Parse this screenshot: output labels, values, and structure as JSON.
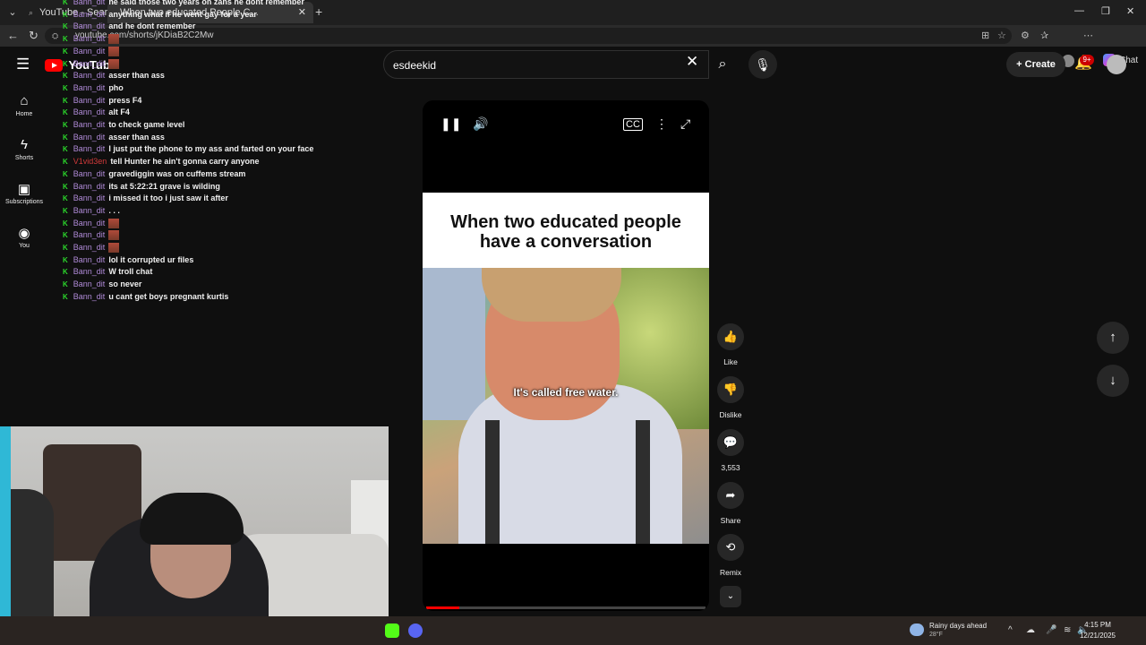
{
  "browser": {
    "tab_menu_icon": "chevron-down-icon",
    "tabs": [
      {
        "title": "YouTube - Search"
      },
      {
        "title": "When two educated People C..."
      }
    ],
    "url": "youtube.com/shorts/jKDiaB2C2Mw"
  },
  "youtube": {
    "logo_text": "YouTube",
    "search": {
      "value": "esdeekid",
      "placeholder": "Search"
    },
    "create_label": "Create",
    "notif_count": "9+"
  },
  "guide": [
    {
      "label": "Home",
      "icon": "home-icon"
    },
    {
      "label": "Shorts",
      "icon": "shorts-icon"
    },
    {
      "label": "Subscriptions",
      "icon": "subscriptions-icon"
    },
    {
      "label": "You",
      "icon": "you-icon"
    }
  ],
  "chat": [
    {
      "user": "Bann_dit",
      "msg": "he said those two years on zans he dont remember"
    },
    {
      "user": "Bann_dit",
      "msg": "anything what if he went gay for a year"
    },
    {
      "user": "Bann_dit",
      "msg": "and he dont remember"
    },
    {
      "user": "Bann_dit",
      "msg": ""
    },
    {
      "user": "Bann_dit",
      "msg": ""
    },
    {
      "user": "Bann_dit",
      "msg": ""
    },
    {
      "user": "Bann_dit",
      "msg": "asser than ass"
    },
    {
      "user": "Bann_dit",
      "msg": "pho"
    },
    {
      "user": "Bann_dit",
      "msg": "press F4"
    },
    {
      "user": "Bann_dit",
      "msg": "alt F4"
    },
    {
      "user": "Bann_dit",
      "msg": "to check game level"
    },
    {
      "user": "Bann_dit",
      "msg": "asser than ass"
    },
    {
      "user": "Bann_dit",
      "msg": "I just put the phone to my ass and farted on your face"
    },
    {
      "user": "V1vid3en",
      "msg": "tell Hunter he ain't gonna carry anyone"
    },
    {
      "user": "Bann_dit",
      "msg": "gravediggin was on cuffems stream"
    },
    {
      "user": "Bann_dit",
      "msg": "its at 5:22:21 grave is wilding"
    },
    {
      "user": "Bann_dit",
      "msg": "i missed it too i just saw it after"
    },
    {
      "user": "Bann_dit",
      "msg": ". . ."
    },
    {
      "user": "Bann_dit",
      "msg": ""
    },
    {
      "user": "Bann_dit",
      "msg": ""
    },
    {
      "user": "Bann_dit",
      "msg": ""
    },
    {
      "user": "Bann_dit",
      "msg": "lol it corrupted ur files"
    },
    {
      "user": "Bann_dit",
      "msg": "W troll chat"
    },
    {
      "user": "Bann_dit",
      "msg": "so never"
    },
    {
      "user": "Bann_dit",
      "msg": "u cant get boys pregnant kurtis"
    }
  ],
  "short": {
    "caption": "When two educated people have a conversation",
    "subtitle": "It's called free water.",
    "progress": 0.12
  },
  "actions": [
    {
      "label": "Like",
      "icon": "thumb-up-icon"
    },
    {
      "label": "Dislike",
      "icon": "thumb-down-icon"
    },
    {
      "label": "3,553",
      "icon": "comment-icon"
    },
    {
      "label": "Share",
      "icon": "share-icon"
    },
    {
      "label": "Remix",
      "icon": "remix-icon"
    }
  ],
  "taskbar": {
    "weather_title": "Rainy days ahead",
    "weather_temp": "28°F",
    "time": "4:15 PM",
    "date": "12/21/2025"
  },
  "colors": {
    "accent": "#ff0000",
    "chat_badge": "#2bd62b",
    "chat_user": "#b18bd9"
  }
}
